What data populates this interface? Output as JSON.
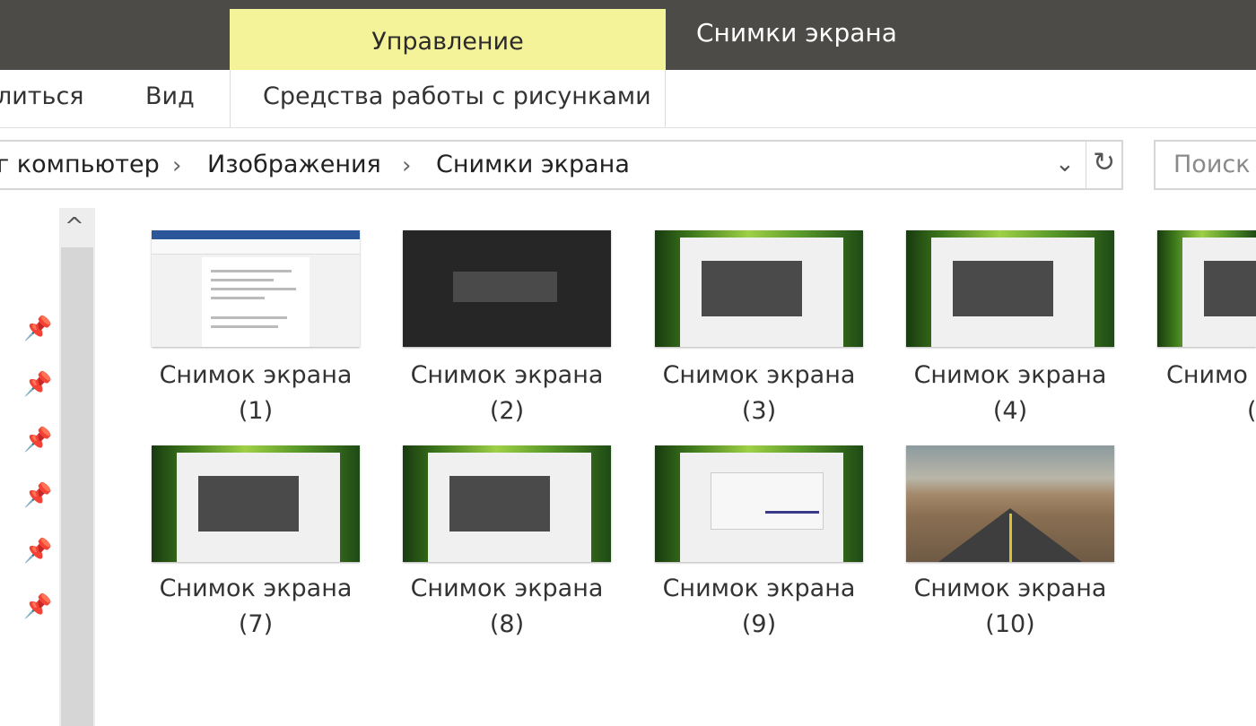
{
  "ribbon_top": {
    "context_tab": "Управление",
    "window_title": "Снимки экрана"
  },
  "ribbon": {
    "share": "литься",
    "view": "Вид",
    "picture_tools": "Средства работы с рисунками"
  },
  "address": {
    "crumbs": [
      "г компьютер",
      "Изображения",
      "Снимки экрана"
    ],
    "separator": "›",
    "dropdown_icon": "chevron-down-icon",
    "refresh_icon": "refresh-icon"
  },
  "search": {
    "placeholder": "Поиск"
  },
  "nav": {
    "scroll_up": "^",
    "pins": [
      "pin-icon",
      "pin-icon",
      "pin-icon",
      "pin-icon",
      "pin-icon",
      "pin-icon"
    ]
  },
  "files": [
    {
      "name": "Снимок экрана",
      "num": "(1)",
      "thumb": "document"
    },
    {
      "name": "Снимок экрана",
      "num": "(2)",
      "thumb": "dark"
    },
    {
      "name": "Снимок экрана",
      "num": "(3)",
      "thumb": "green-dialog"
    },
    {
      "name": "Снимок экрана",
      "num": "(4)",
      "thumb": "green-dialog"
    },
    {
      "name": "Снимо",
      "num": "(",
      "thumb": "green-dialog"
    },
    {
      "name": "Снимок экрана",
      "num": "(7)",
      "thumb": "green-dialog"
    },
    {
      "name": "Снимок экрана",
      "num": "(8)",
      "thumb": "green-dialog"
    },
    {
      "name": "Снимок экрана",
      "num": "(9)",
      "thumb": "green-light-dialog"
    },
    {
      "name": "Снимок экрана",
      "num": "(10)",
      "thumb": "road"
    }
  ],
  "colors": {
    "titlebar": "#4d4b47",
    "context_tab": "#f5f39a"
  }
}
